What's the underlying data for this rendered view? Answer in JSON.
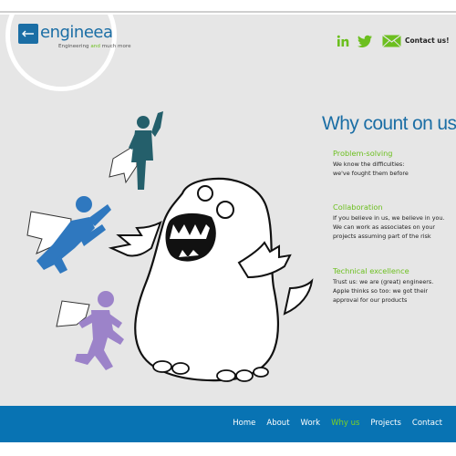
{
  "brand": {
    "name": "engineea",
    "tagline_pre": "Engineering ",
    "tagline_mid": "and",
    "tagline_post": " much more",
    "color": "#1b6ea5",
    "accent": "#6cbf1f"
  },
  "header": {
    "social_icons": [
      "linkedin-icon",
      "twitter-icon",
      "mail-icon"
    ],
    "contact_label": "Contact us!"
  },
  "main": {
    "headline": "Why count on us",
    "headline_mark": "?",
    "features": [
      {
        "title": "Problem-solving",
        "lines": [
          "We know the difficulties:",
          "we've fought them before"
        ]
      },
      {
        "title": "Collaboration",
        "lines": [
          "If you believe in us, we believe in you.",
          "We can work as associates on your",
          "projects assuming part of the risk"
        ]
      },
      {
        "title": "Technical excellence",
        "lines": [
          "Trust us: we are (great) engineers.",
          "Apple thinks so too: we got their",
          "approval for our products"
        ]
      }
    ]
  },
  "footer": {
    "nav": [
      {
        "label": "Home",
        "active": false
      },
      {
        "label": "About",
        "active": false
      },
      {
        "label": "Work",
        "active": false
      },
      {
        "label": "Why us",
        "active": true
      },
      {
        "label": "Projects",
        "active": false
      },
      {
        "label": "Contact",
        "active": false
      }
    ],
    "background": "#0873b3",
    "active_color": "#7ed321"
  }
}
